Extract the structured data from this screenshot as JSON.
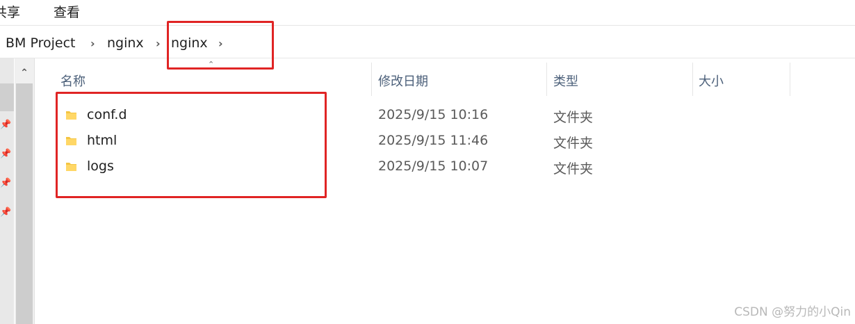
{
  "ribbon": {
    "tabs": [
      "共享",
      "查看"
    ]
  },
  "breadcrumb": {
    "items": [
      "BM Project",
      "nginx",
      "nginx"
    ],
    "separator": "›"
  },
  "columns": {
    "name": "名称",
    "modified": "修改日期",
    "type": "类型",
    "size": "大小"
  },
  "files": [
    {
      "name": "conf.d",
      "modified": "2025/9/15 10:16",
      "type": "文件夹",
      "icon": "folder-icon"
    },
    {
      "name": "html",
      "modified": "2025/9/15 11:46",
      "type": "文件夹",
      "icon": "folder-icon"
    },
    {
      "name": "logs",
      "modified": "2025/9/15 10:07",
      "type": "文件夹",
      "icon": "folder-icon"
    }
  ],
  "watermark": "CSDN @努力的小Qin",
  "colors": {
    "highlight": "#e02424",
    "folder": "#f4c542",
    "header_text": "#4c607a"
  }
}
